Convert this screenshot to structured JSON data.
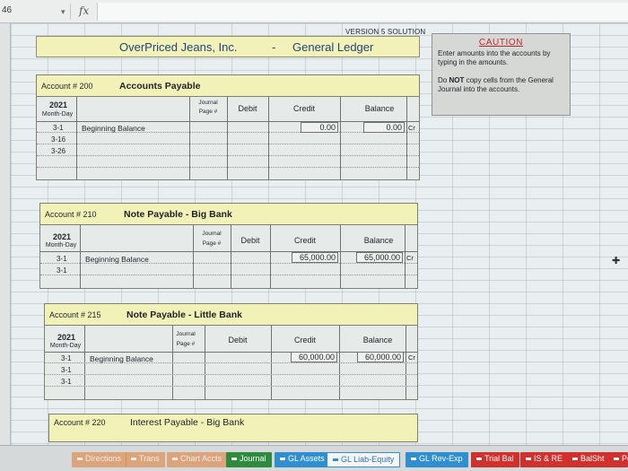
{
  "formula_bar": {
    "cell_ref": "46",
    "fx_symbol": "fx",
    "dropdown_icon": "chevron-down-icon"
  },
  "version_label": "VERSION 5 SOLUTION",
  "title": {
    "company": "OverPriced Jeans, Inc.",
    "separator": "-",
    "ledger": "General Ledger"
  },
  "caution": {
    "title": "CAUTION",
    "line1": "Enter amounts into the accounts by typing in the amounts.",
    "line2_bold": "NOT",
    "line2_pre": "Do ",
    "line2_post": " copy cells from the General Journal into the accounts."
  },
  "columns": {
    "year": "2021",
    "month_day": "Month-Day",
    "journal": "Journal",
    "page": "Page #",
    "debit": "Debit",
    "credit": "Credit",
    "balance": "Balance"
  },
  "accounts": [
    {
      "number_label": "Account # 200",
      "name": "Accounts Payable",
      "rows": [
        {
          "date": "3-1",
          "desc": "Beginning Balance",
          "credit": "0.00",
          "balance": "0.00",
          "side": "Cr"
        },
        {
          "date": "3-16"
        },
        {
          "date": "3-26"
        }
      ]
    },
    {
      "number_label": "Account # 210",
      "name": "Note Payable - Big Bank",
      "rows": [
        {
          "date": "3-1",
          "desc": "Beginning Balance",
          "credit": "65,000.00",
          "balance": "65,000.00",
          "side": "Cr"
        },
        {
          "date": "3-1"
        }
      ]
    },
    {
      "number_label": "Account # 215",
      "name": "Note Payable - Little Bank",
      "rows": [
        {
          "date": "3-1",
          "desc": "Beginning Balance",
          "credit": "60,000.00",
          "balance": "60,000.00",
          "side": "Cr"
        },
        {
          "date": "3-1"
        },
        {
          "date": "3-1"
        }
      ]
    },
    {
      "number_label": "Account # 220",
      "name": "Interest Payable - Big Bank"
    }
  ],
  "tabs": [
    {
      "label": "Directions",
      "color": "#e07a2e"
    },
    {
      "label": "Trans",
      "color": "#e07a2e"
    },
    {
      "label": "Chart Accts",
      "color": "#e07a2e"
    },
    {
      "label": "Journal",
      "color": "#2e8b3e"
    },
    {
      "label": "GL Assets",
      "color": "#2f8fd0"
    },
    {
      "label": "GL Liab-Equity",
      "color": "#2f8fd0"
    },
    {
      "label": "GL Rev-Exp",
      "color": "#2f8fd0"
    },
    {
      "label": "Trial Bal",
      "color": "#d0312d"
    },
    {
      "label": "IS & RE",
      "color": "#d0312d"
    },
    {
      "label": "BalSht",
      "color": "#d0312d"
    },
    {
      "label": "Po",
      "color": "#d0312d"
    }
  ]
}
